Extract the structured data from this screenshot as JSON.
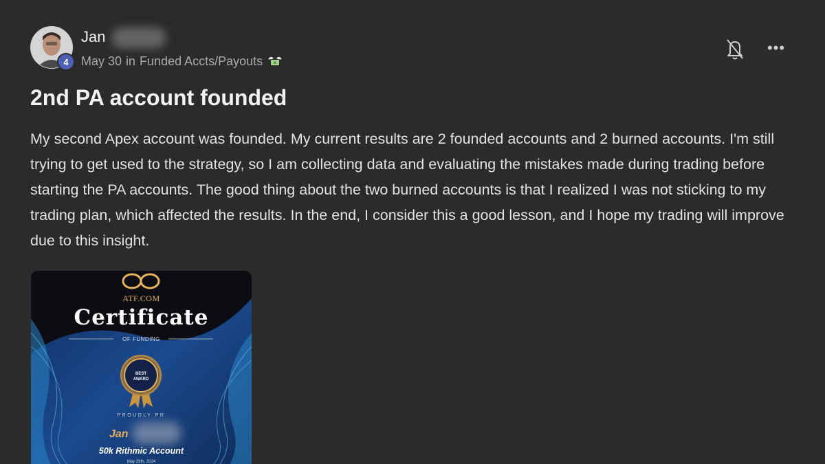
{
  "author": {
    "name": "Jan",
    "level": "4",
    "avatar_icon": "user-avatar-photo"
  },
  "meta": {
    "date": "May 30",
    "in_label": "in",
    "category": "Funded Accts/Payouts",
    "category_icon": "money-wings-icon"
  },
  "actions": {
    "notify_icon": "bell-off-icon",
    "more_label": "•••"
  },
  "post": {
    "title": "2nd PA account founded",
    "body": "My second Apex account was founded. My current results are 2 founded accounts and 2 burned accounts. I'm still trying to get used to the strategy, so I am collecting data and evaluating the mistakes made during trading before starting the PA accounts. The good thing about the two burned accounts is that I realized I was not sticking to my trading plan, which affected the results. In the end, I consider this a good lesson, and I hope my trading will improve due to this insight."
  },
  "attachment": {
    "brand": "ATF.COM",
    "title": "Certificate",
    "subtitle": "OF FUNDING",
    "award_line1": "BEST",
    "award_line2": "AWARD",
    "proudly": "PROUDLY PR",
    "recipient": "Jan",
    "account": "50k Rithmic Account",
    "date": "May 29th, 2024"
  },
  "colors": {
    "background": "#2b2b2b",
    "level_badge": "#4e5fb8",
    "cert_gold": "#e8b35a",
    "cert_blue": "#1b3f7a"
  }
}
